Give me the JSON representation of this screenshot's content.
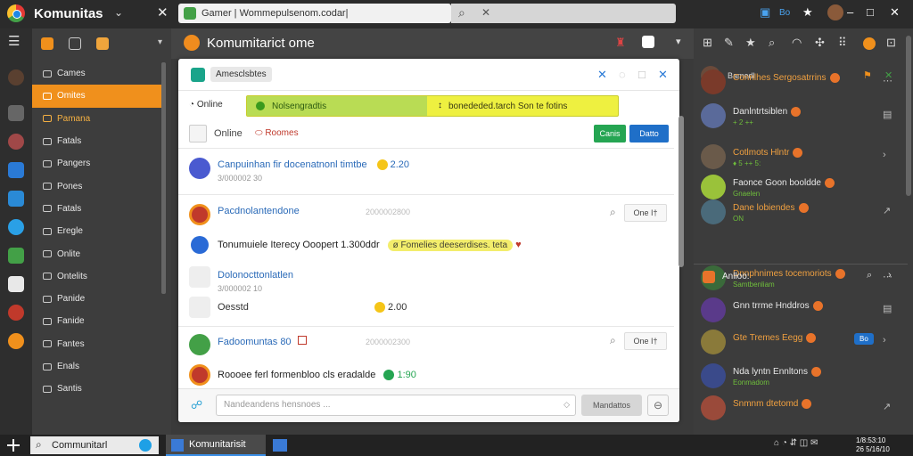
{
  "topbar": {
    "app_title": "Komunitas",
    "address": "Gamer | Wommepulsenom.codar|",
    "right_icons": [
      "bookmark-icon",
      "reader-icon",
      "star-icon",
      "avatar",
      "minimize-icon",
      "maximize-icon",
      "close-icon"
    ],
    "right_label": "Bo"
  },
  "nav": {
    "items": [
      {
        "label": "Cames",
        "state": "normal"
      },
      {
        "label": "Omites",
        "state": "active"
      },
      {
        "label": "Pamana",
        "state": "highlight"
      },
      {
        "label": "Fatals",
        "state": "normal"
      },
      {
        "label": "Pangers",
        "state": "normal"
      },
      {
        "label": "Pones",
        "state": "normal"
      },
      {
        "label": "Fatals",
        "state": "normal"
      },
      {
        "label": "Eregle",
        "state": "normal"
      },
      {
        "label": "Onlite",
        "state": "normal"
      },
      {
        "label": "Ontelits",
        "state": "normal"
      },
      {
        "label": "Panide",
        "state": "normal"
      },
      {
        "label": "Fanide",
        "state": "normal"
      },
      {
        "label": "Fantes",
        "state": "normal"
      },
      {
        "label": "Enals",
        "state": "normal"
      },
      {
        "label": "Santis",
        "state": "normal"
      }
    ]
  },
  "center": {
    "title": "Komumitarict ome",
    "window_label": "Amesclsbtes",
    "tab_online": "Online",
    "banner_left": "Nolsengradtis",
    "banner_right": "bonededed.tarch Son te fotins",
    "filter_online": "Online",
    "filter_room": "Roomes",
    "btn_green": "Canis",
    "btn_blue": "Datto",
    "messages": [
      {
        "title": "Canpuinhan fir docenatnonl timtbe",
        "sub": "3/000002 30",
        "emoji_text": "2.20"
      },
      {
        "title": "Pacdnolantendone",
        "sub": "",
        "time": "2000002800",
        "reply": "One  I†"
      },
      {
        "title": "Tonumuiele Iterecy Ooopert 1.300ddr",
        "tag": "ø Fomelies deeserdises. teta"
      },
      {
        "title": "Dolonocttonlatlen",
        "sub": "3/000002 10"
      },
      {
        "title": "Oesstd",
        "emoji_text": "2.00"
      },
      {
        "title": "Fadoomuntas 80",
        "time": "2000002300",
        "reply": "One  I†"
      },
      {
        "title": "Roooee ferl formenbloo cls eradalde",
        "badge": "1:90"
      }
    ],
    "composer_placeholder": "Nandeandens hensnoes ...",
    "send_label": "Mandattos"
  },
  "right_panel": {
    "group_head": "Bamedl",
    "rows": [
      {
        "name": "Connlhes Sergosatrrins",
        "sub": ""
      },
      {
        "name": "Danlntrtsiblen",
        "sub": "+ 2 ++"
      },
      {
        "name": "Cotlmots Hlntr",
        "sub": "♦ 5 ++ 5:"
      },
      {
        "name": "Faonce Goon booldde",
        "sub": "Gnaelen"
      },
      {
        "name": "Dane lobiendes",
        "sub": "ON"
      }
    ],
    "section_label": "Anlloo:",
    "rows2": [
      {
        "name": "Dnnphnimes tocemoriots",
        "sub": "Samtbenliam"
      },
      {
        "name": "Gnn trrme Hnddros",
        "sub": ""
      },
      {
        "name": "Gte Tremes Eegg",
        "sub": "",
        "tag": "Bo"
      },
      {
        "name": "Nda lyntn Ennltons",
        "sub": "Eonmadom"
      },
      {
        "name": "Snmnm dtetomd",
        "sub": ""
      }
    ]
  },
  "taskbar": {
    "search_text": "Communitarl",
    "app_label": "Komunitarisit",
    "time": "1/8:53:10",
    "date": "26 5/16/10"
  },
  "colors": {
    "accent": "#f0901c",
    "green_button": "#25a552",
    "blue_button": "#1f6fc8",
    "banner": "#eef040"
  }
}
